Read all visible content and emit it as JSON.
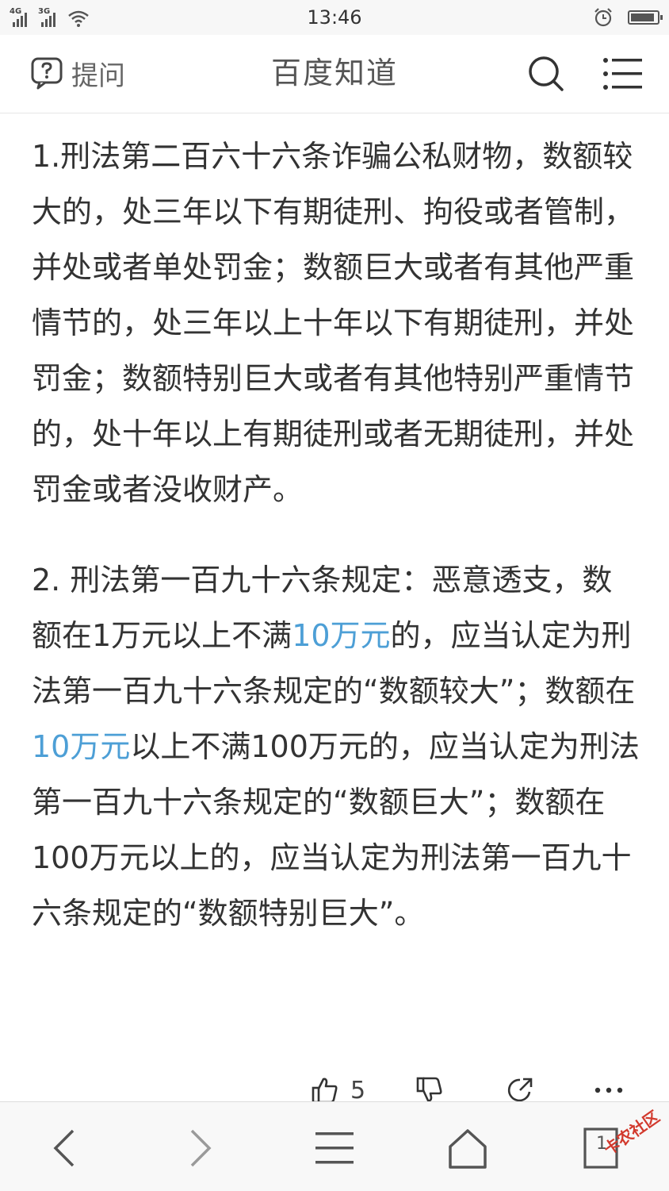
{
  "status_bar": {
    "network1": "4G",
    "network2": "3G",
    "time": "13:46",
    "alarm_icon": "alarm-clock-icon",
    "battery_level": 0.9
  },
  "nav": {
    "ask_label": "提问",
    "title": "百度知道",
    "icons": [
      "question-bubble-icon",
      "search-icon",
      "menu-icon"
    ]
  },
  "content": {
    "p1": "1.刑法第二百六十六条诈骗公私财物，数额较大的，处三年以下有期徒刑、拘役或者管制，并处或者单处罚金；数额巨大或者有其他严重情节的，处三年以上十年以下有期徒刑，并处罚金；数额特别巨大或者有其他特别严重情节的，处十年以上有期徒刑或者无期徒刑，并处罚金或者没收财产。",
    "p2": {
      "s1": "2. 刑法第一百九十六条规定：恶意透支，数额在1万元以上不满",
      "link1": "10万元",
      "s2": "的，应当认定为刑法第一百九十六条规定的“数额较大”；数额在",
      "link2": "10万元",
      "s3": "以上不满100万元的，应当认定为刑法第一百九十六条规定的“数额巨大”；数额在100万元以上的，应当认定为刑法第一百九十六条规定的“数额特别巨大”。"
    }
  },
  "actions": {
    "like_count": "5",
    "icons": [
      "thumbs-up-icon",
      "thumbs-down-icon",
      "share-icon",
      "more-icon"
    ]
  },
  "bottom_bar": {
    "tabs_count": "1",
    "icons": [
      "back-icon",
      "forward-icon",
      "menu-icon",
      "home-icon",
      "tabs-icon"
    ]
  },
  "watermark": "卡农社区",
  "colors": {
    "link": "#4d9fd6",
    "text": "#333333"
  }
}
